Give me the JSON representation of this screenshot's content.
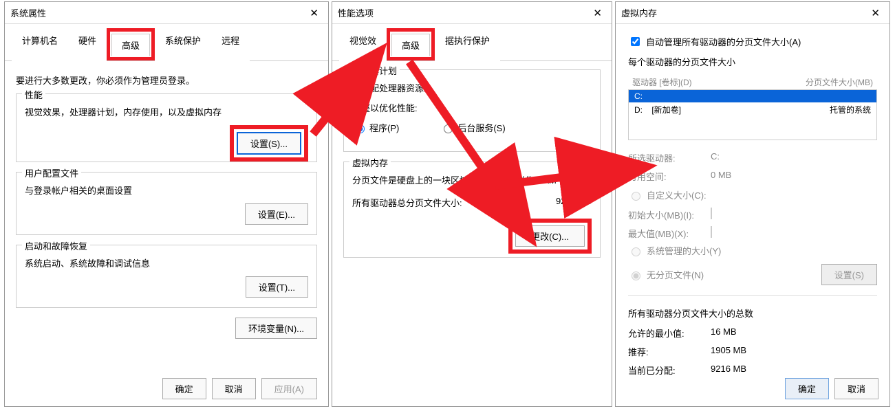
{
  "dialog1": {
    "title": "系统属性",
    "tabs": [
      "计算机名",
      "硬件",
      "高级",
      "系统保护",
      "远程"
    ],
    "activeTab": "高级",
    "admin_note": "要进行大多数更改，你必须作为管理员登录。",
    "perf": {
      "legend": "性能",
      "desc": "视觉效果，处理器计划，内存使用，以及虚拟内存",
      "btn": "设置(S)..."
    },
    "profile": {
      "legend": "用户配置文件",
      "desc": "与登录帐户相关的桌面设置",
      "btn": "设置(E)..."
    },
    "startup": {
      "legend": "启动和故障恢复",
      "desc": "系统启动、系统故障和调试信息",
      "btn": "设置(T)..."
    },
    "env_btn": "环境变量(N)...",
    "ok": "确定",
    "cancel": "取消",
    "apply": "应用(A)"
  },
  "dialog2": {
    "title": "性能选项",
    "tabs": [
      "视觉效",
      "高级",
      "据执行保护"
    ],
    "activeTab": "高级",
    "cpu": {
      "legend": "处理器计划",
      "desc": "可分配处理器资源。",
      "adjust": "调整以优化性能:",
      "opt1": "程序(P)",
      "opt2": "后台服务(S)"
    },
    "vm": {
      "legend": "虚拟内存",
      "desc": "分页文件是硬盘上的一块区域，Windows 当作 RAM 使用。",
      "total_label": "所有驱动器总分页文件大小:",
      "total_value": "9216 MB",
      "change_btn": "更改(C)..."
    }
  },
  "dialog3": {
    "title": "虚拟内存",
    "auto_label": "自动管理所有驱动器的分页文件大小(A)",
    "list_title": "每个驱动器的分页文件大小",
    "list_head_drive": "驱动器 [卷标](D)",
    "list_head_size": "分页文件大小(MB)",
    "rows": [
      {
        "drive": "C:",
        "label": "",
        "size": ""
      },
      {
        "drive": "D:",
        "label": "[新加卷]",
        "size": "托管的系统"
      }
    ],
    "sel_drive_label": "所选驱动器:",
    "sel_drive_val": "C:",
    "avail_label": "可用空间:",
    "avail_val": "0 MB",
    "custom": "自定义大小(C):",
    "init_label": "初始大小(MB)(I):",
    "max_label": "最大值(MB)(X):",
    "sysman": "系统管理的大小(Y)",
    "nopage": "无分页文件(N)",
    "set_btn": "设置(S)",
    "totals_legend": "所有驱动器分页文件大小的总数",
    "min_label": "允许的最小值:",
    "min_val": "16 MB",
    "rec_label": "推荐:",
    "rec_val": "1905 MB",
    "cur_label": "当前已分配:",
    "cur_val": "9216 MB",
    "ok": "确定",
    "cancel": "取消"
  }
}
